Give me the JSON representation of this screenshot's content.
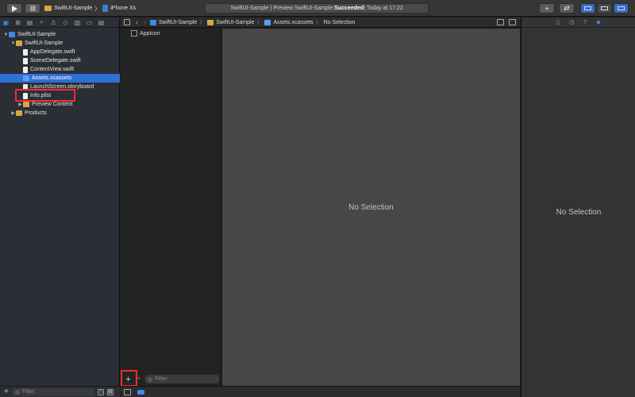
{
  "toolbar": {
    "scheme_app": "SwiftUI-Sample",
    "scheme_separator": "〉",
    "scheme_device": "iPhone Xs",
    "activity_prefix": "SwiftUI-Sample | Preview SwiftUI-Sample: ",
    "activity_status": "Succeeded",
    "activity_suffix": " | Today at 17:22",
    "plus_label": "+",
    "swap_label": "⇄"
  },
  "navigator": {
    "tree": [
      {
        "label": "SwiftUI-Sample",
        "icon": "project-icon",
        "disclosure": "▼",
        "level": 0
      },
      {
        "label": "SwiftUI-Sample",
        "icon": "folder-icon",
        "disclosure": "▼",
        "level": 1
      },
      {
        "label": "AppDelegate.swift",
        "icon": "swift-file-icon",
        "disclosure": "",
        "level": 2
      },
      {
        "label": "SceneDelegate.swift",
        "icon": "swift-file-icon",
        "disclosure": "",
        "level": 2
      },
      {
        "label": "ContentView.swift",
        "icon": "swift-file-icon",
        "disclosure": "",
        "level": 2
      },
      {
        "label": "Assets.xcassets",
        "icon": "asset-catalog-icon",
        "disclosure": "",
        "level": 2,
        "selected": true
      },
      {
        "label": "LaunchScreen.storyboard",
        "icon": "storyboard-icon",
        "disclosure": "",
        "level": 2
      },
      {
        "label": "Info.plist",
        "icon": "plist-icon",
        "disclosure": "",
        "level": 2
      },
      {
        "label": "Preview Content",
        "icon": "folder-icon",
        "disclosure": "▶",
        "level": 2
      },
      {
        "label": "Products",
        "icon": "folder-icon",
        "disclosure": "▶",
        "level": 1
      }
    ],
    "filter_placeholder": "Filter",
    "add_label": "+"
  },
  "jumpbar": {
    "crumbs": [
      "SwiftUI-Sample",
      "SwiftUI-Sample",
      "Assets.xcassets",
      "No Selection"
    ],
    "separator": "〉"
  },
  "assets": {
    "items": [
      "AppIcon"
    ],
    "add_label": "+",
    "remove_label": "−",
    "filter_placeholder": "Filter"
  },
  "canvas": {
    "empty_text": "No Selection"
  },
  "inspector": {
    "empty_text": "No Selection"
  },
  "colors": {
    "accent": "#2f6fd6",
    "highlight": "#ff2a2a",
    "status_success": "#ffffff"
  }
}
